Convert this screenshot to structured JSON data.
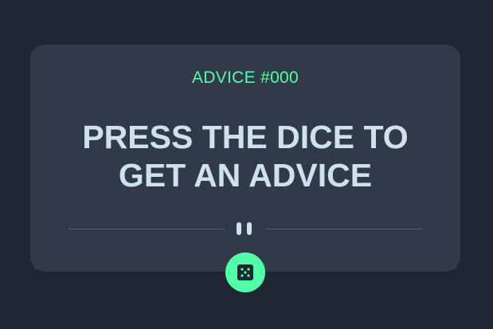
{
  "card": {
    "advice_id": "ADVICE #000",
    "quote": "PRESS THE DICE TO GET AN ADVICE"
  },
  "icons": {
    "divider_icon": "pause-icon",
    "dice_icon": "dice-icon"
  },
  "colors": {
    "background": "#202632",
    "card": "#313a49",
    "accent": "#52ffa8",
    "text": "#cee3e9",
    "divider": "#4f5d74"
  }
}
